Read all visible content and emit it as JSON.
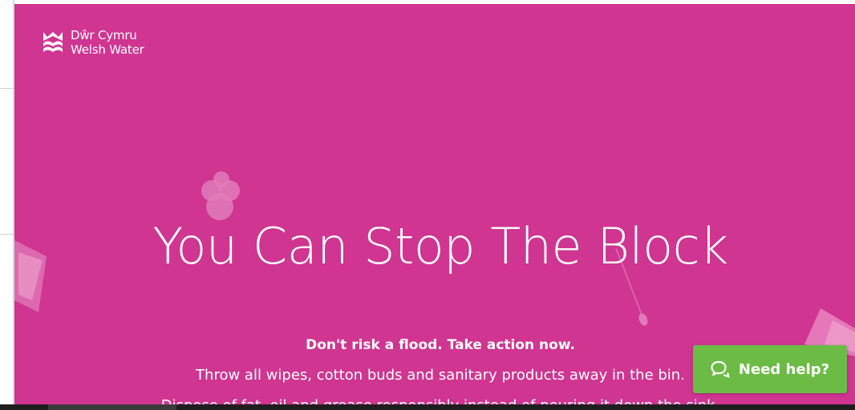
{
  "brand": {
    "line1": "Dŵr Cymru",
    "line2": "Welsh Water",
    "logo_icon": "welsh-water-crown-logo"
  },
  "hero": {
    "headline": "You Can Stop The Block",
    "subhead": "Don't risk a flood. Take action now.",
    "line1": "Throw all wipes, cotton buds and sanitary products away in the bin.",
    "line2": "Dispose of fat, oil and grease responsibly instead of pouring it down the sink."
  },
  "help_widget": {
    "label": "Need help?",
    "icon": "chat-bubbles-icon"
  },
  "colors": {
    "hero_bg": "#cf3591",
    "help_bg": "#6cbb45",
    "text": "#ffffff"
  }
}
